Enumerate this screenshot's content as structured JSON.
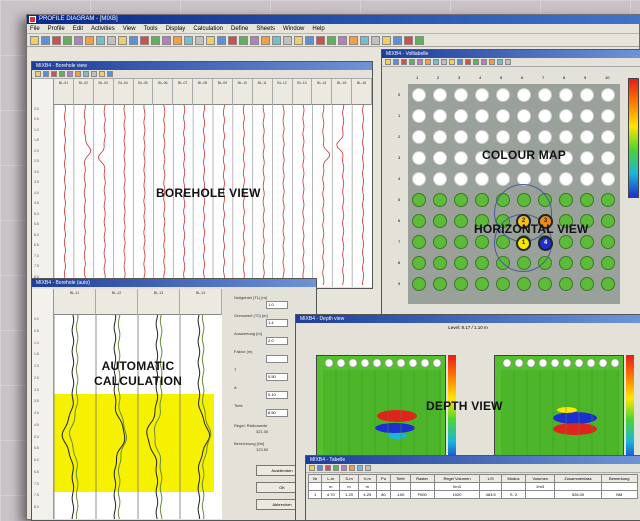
{
  "app": {
    "title": "PROFILE DIAGRAM - [MIXB]",
    "menu": [
      "File",
      "Profile",
      "Edit",
      "Activities",
      "View",
      "Tools",
      "Display",
      "Calculation",
      "Define",
      "Sheets",
      "Window",
      "Help"
    ]
  },
  "borehole": {
    "window_title": "MIXB4 - Borehole view",
    "label": "BOREHOLE VIEW",
    "columns": [
      "BL-01",
      "BL-02",
      "BL-03",
      "BL-04",
      "BL-05",
      "BL-06",
      "BL-07",
      "BL-08",
      "BL-09",
      "BL-10",
      "BL-11",
      "BL-12",
      "BL-13",
      "BL-14",
      "BL-15",
      "BL-16"
    ],
    "depths": [
      "0.0",
      "0.5",
      "1.0",
      "1.5",
      "2.0",
      "2.5",
      "3.0",
      "3.5",
      "4.0",
      "4.5",
      "5.0",
      "5.5",
      "6.0",
      "6.5",
      "7.0",
      "7.5",
      "8.0"
    ]
  },
  "colourmap": {
    "window_title": "MIXB4 - Volltabelle",
    "label_colour": "COLOUR MAP",
    "label_horizontal": "HORIZONTAL VIEW",
    "selected_points": [
      "2",
      "3",
      "1",
      "4"
    ],
    "y_axis": [
      "0",
      "1",
      "2",
      "3",
      "4",
      "5",
      "6",
      "7",
      "8",
      "9"
    ],
    "x_axis": [
      "1",
      "2",
      "3",
      "4",
      "5",
      "6",
      "7",
      "8",
      "9",
      "10"
    ]
  },
  "autocalc": {
    "window_title": "MIXB4 - Borehole (auto)",
    "label_line1": "AUTOMATIC",
    "label_line2": "CALCULATION",
    "columns": [
      "BL-11",
      "BL-12",
      "BL-13",
      "BL-14"
    ],
    "params": [
      {
        "label": "Nullgebiet (T1) [m]",
        "value": "1.0"
      },
      {
        "label": "Grenzwert (T2) [m]",
        "value": "1.4"
      },
      {
        "label": "Auswertung [m]",
        "value": "2.0"
      },
      {
        "label": "Faktor (m)",
        "value": ""
      },
      {
        "label": "T",
        "value": "0.50"
      },
      {
        "label": "A",
        "value": "0.10"
      },
      {
        "label": "Tiefe",
        "value": "8.50"
      }
    ],
    "extra_labels": [
      "Regel: Risikowerte",
      "Berechnung [l/m]"
    ],
    "extra_values": [
      "321.05",
      "123.50"
    ],
    "buttons": [
      "Ausblenden",
      "OK",
      "Abbrechen"
    ]
  },
  "depthview": {
    "window_title": "MIXB4 - Depth view",
    "label": "DEPTH VIEW",
    "subtitle": "Level: 8.17 / 1.10 m"
  },
  "table": {
    "window_title": "MIXB4 - Tabelle",
    "headers": [
      "Nr",
      "L-m",
      "S-m",
      "V-m",
      "Pu",
      "Tiefe",
      "Raster",
      "Regel Volumen",
      "L/S",
      "Modus",
      "Volumen",
      "Zusammenfass",
      "Bemerkung"
    ],
    "units": [
      "",
      "m",
      "m",
      "m",
      "",
      "",
      "",
      "l/m3",
      "",
      "",
      "l/m3",
      "",
      ""
    ],
    "row": [
      "1",
      "4.70",
      "1.20",
      "4.25",
      "80",
      "-100",
      "F000",
      "1020",
      "463.5",
      "S. 2",
      "",
      "526.00",
      "NM"
    ]
  },
  "colors": {
    "title_bar": "#0a2a8a",
    "highlight": "#f5f100",
    "anomaly_red": "#e0231c",
    "anomaly_blue": "#1d2fd0",
    "grid_green": "#5dbb3a"
  }
}
